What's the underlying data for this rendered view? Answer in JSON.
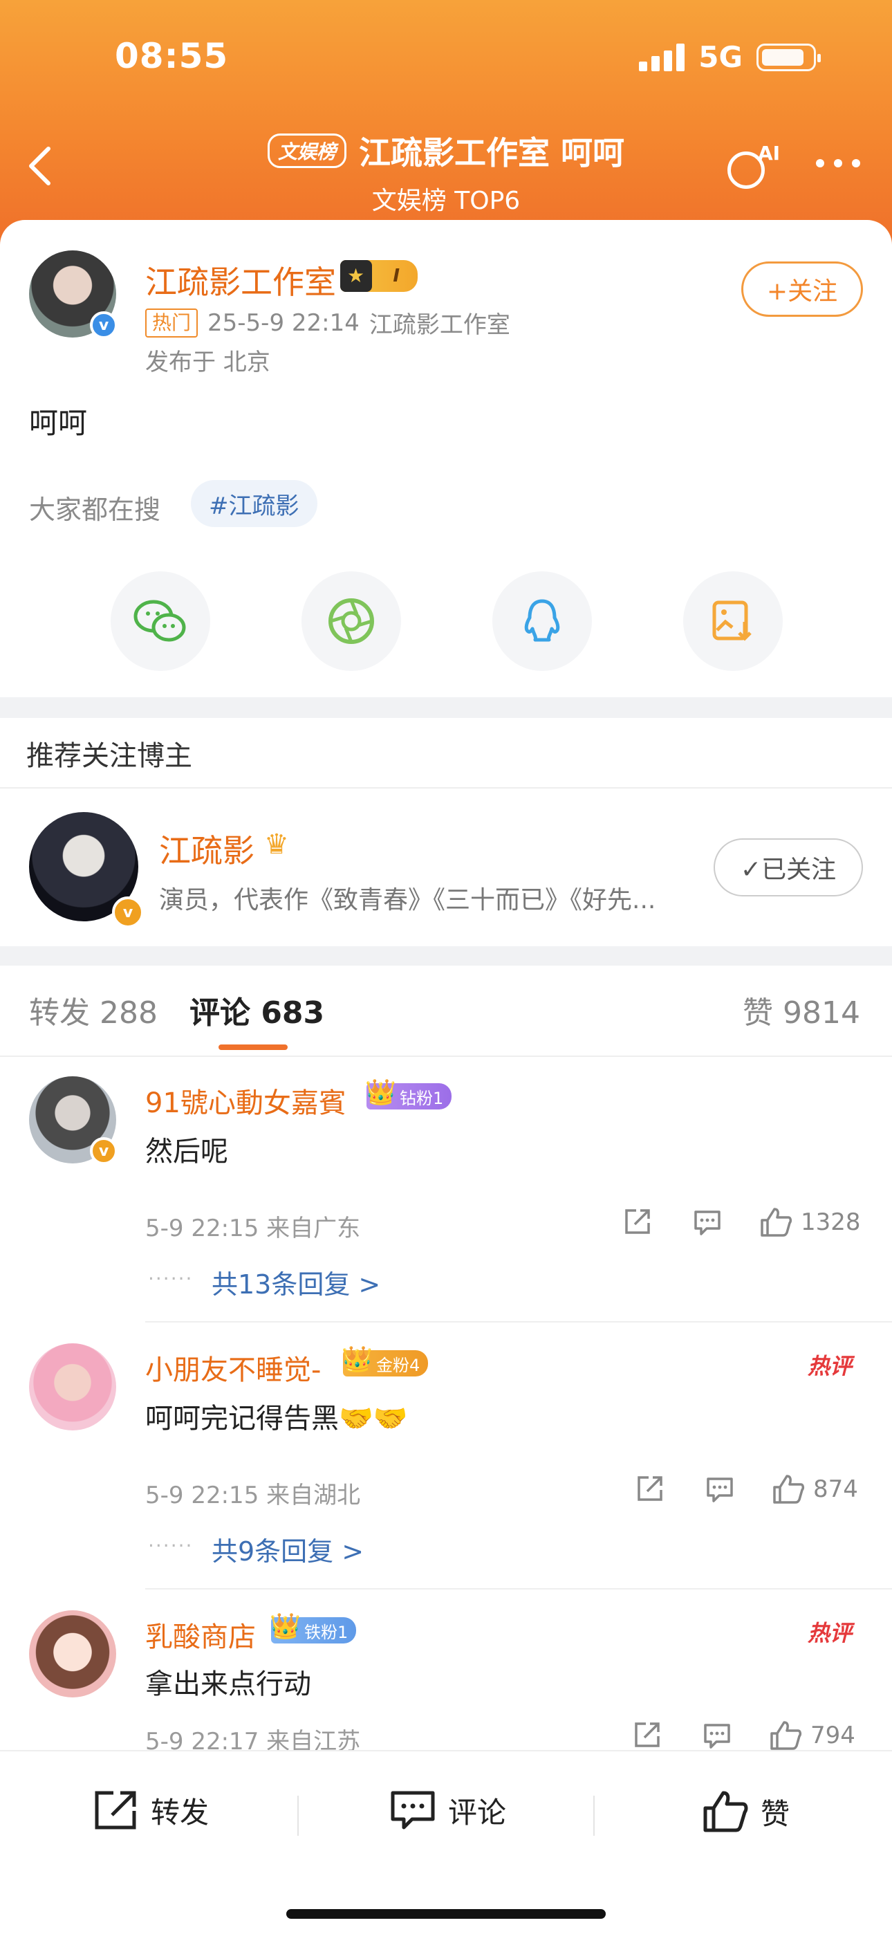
{
  "status": {
    "time": "08:55",
    "network": "5G"
  },
  "header": {
    "tag": "文娱榜",
    "title": "江疏影工作室 呵呵",
    "subtitle": "文娱榜 TOP6",
    "ai_label": "AI"
  },
  "post": {
    "author": "江疏影工作室",
    "level_badge": "I",
    "hot_tag": "热门",
    "time": "25-5-9 22:14",
    "source": "江疏影工作室",
    "location": "发布于 北京",
    "follow_label": "+关注",
    "text": "呵呵",
    "search_label": "大家都在搜",
    "search_chip": "#江疏影"
  },
  "share": [
    "wechat-icon",
    "moments-icon",
    "qq-icon",
    "save-image-icon"
  ],
  "recommend": {
    "title": "推荐关注博主",
    "name": "江疏影",
    "desc": "演员，代表作《致青春》《三十而已》《好先...",
    "followed_label": "✓已关注"
  },
  "tabs": {
    "repost": "转发 288",
    "comment": "评论 683",
    "like": "赞 9814"
  },
  "comments": [
    {
      "name": "91號心動女嘉賓",
      "badge": "钻粉1",
      "text": "然后呢",
      "meta": "5-9 22:15 来自广东",
      "likes": "1328",
      "replies": "共13条回复 >",
      "hot": ""
    },
    {
      "name": "小朋友不睡觉-",
      "badge": "金粉4",
      "text": "呵呵完记得告黑🤝🤝",
      "meta": "5-9 22:15 来自湖北",
      "likes": "874",
      "replies": "共9条回复 >",
      "hot": "热评"
    },
    {
      "name": "乳酸商店",
      "badge": "铁粉1",
      "text": "拿出来点行动",
      "meta": "5-9 22:17 来自江苏",
      "likes": "794",
      "replies": "",
      "hot": "热评"
    }
  ],
  "bottom": {
    "repost": "转发",
    "comment": "评论",
    "like": "赞"
  },
  "colors": {
    "accent": "#f0712b",
    "name": "#e86c17",
    "link": "#3d6fb4"
  }
}
